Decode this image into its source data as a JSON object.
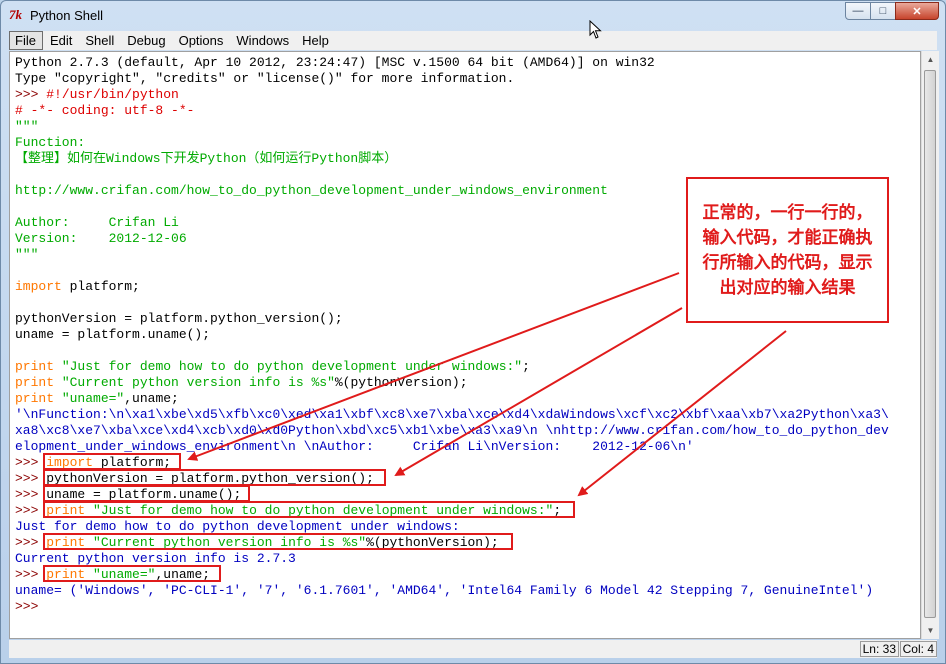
{
  "window": {
    "icon_text": "7k",
    "title": "Python Shell",
    "controls": {
      "minimize": "—",
      "maximize": "□",
      "close": "✕"
    }
  },
  "menu": [
    "File",
    "Edit",
    "Shell",
    "Debug",
    "Options",
    "Windows",
    "Help"
  ],
  "shell_lines": [
    [
      {
        "c": "out",
        "t": "Python 2.7.3 (default, Apr 10 2012, 23:24:47) [MSC v.1500 64 bit (AMD64)] on win32"
      }
    ],
    [
      {
        "c": "out",
        "t": "Type \"copyright\", \"credits\" or \"license()\" for more information."
      }
    ],
    [
      {
        "c": "prompt",
        "t": ">>> "
      },
      {
        "c": "comment",
        "t": "#!/usr/bin/python"
      }
    ],
    [
      {
        "c": "comment",
        "t": "# -*- coding: utf-8 -*-"
      }
    ],
    [
      {
        "c": "string",
        "t": "\"\"\""
      }
    ],
    [
      {
        "c": "string",
        "t": "Function:"
      }
    ],
    [
      {
        "c": "string",
        "t": "【整理】如何在Windows下开发Python（如何运行Python脚本）"
      }
    ],
    [
      {
        "c": "string",
        "t": ""
      }
    ],
    [
      {
        "c": "string",
        "t": "http://www.crifan.com/how_to_do_python_development_under_windows_environment"
      }
    ],
    [
      {
        "c": "string",
        "t": ""
      }
    ],
    [
      {
        "c": "string",
        "t": "Author:     Crifan Li"
      }
    ],
    [
      {
        "c": "string",
        "t": "Version:    2012-12-06"
      }
    ],
    [
      {
        "c": "string",
        "t": "\"\"\""
      }
    ],
    [
      {
        "c": "code",
        "t": ""
      }
    ],
    [
      {
        "c": "kw",
        "t": "import"
      },
      {
        "c": "code",
        "t": " platform;"
      }
    ],
    [
      {
        "c": "code",
        "t": ""
      }
    ],
    [
      {
        "c": "code",
        "t": "pythonVersion = platform.python_version();"
      }
    ],
    [
      {
        "c": "code",
        "t": "uname = platform.uname();"
      }
    ],
    [
      {
        "c": "code",
        "t": ""
      }
    ],
    [
      {
        "c": "kw",
        "t": "print"
      },
      {
        "c": "code",
        "t": " "
      },
      {
        "c": "string",
        "t": "\"Just for demo how to do python development under windows:\""
      },
      {
        "c": "code",
        "t": ";"
      }
    ],
    [
      {
        "c": "kw",
        "t": "print"
      },
      {
        "c": "code",
        "t": " "
      },
      {
        "c": "string",
        "t": "\"Current python version info is %s\""
      },
      {
        "c": "code",
        "t": "%(pythonVersion);"
      }
    ],
    [
      {
        "c": "kw",
        "t": "print"
      },
      {
        "c": "code",
        "t": " "
      },
      {
        "c": "string",
        "t": "\"uname=\""
      },
      {
        "c": "code",
        "t": ",uname;"
      }
    ],
    [
      {
        "c": "res",
        "t": "'\\nFunction:\\n\\xa1\\xbe\\xd5\\xfb\\xc0\\xed\\xa1\\xbf\\xc8\\xe7\\xba\\xce\\xd4\\xdaWindows\\xcf\\xc2\\xbf\\xaa\\xb7\\xa2Python\\xa3\\"
      }
    ],
    [
      {
        "c": "res",
        "t": "xa8\\xc8\\xe7\\xba\\xce\\xd4\\xcb\\xd0\\xd0Python\\xbd\\xc5\\xb1\\xbe\\xa3\\xa9\\n \\nhttp://www.crifan.com/how_to_do_python_dev"
      }
    ],
    [
      {
        "c": "res",
        "t": "elopment_under_windows_environment\\n \\nAuthor:     Crifan Li\\nVersion:    2012-12-06\\n'"
      }
    ],
    [
      {
        "c": "prompt",
        "t": ">>> "
      },
      {
        "c": "kw",
        "t": "import"
      },
      {
        "c": "code",
        "t": " platform;"
      }
    ],
    [
      {
        "c": "prompt",
        "t": ">>> "
      },
      {
        "c": "code",
        "t": "pythonVersion = platform.python_version();"
      }
    ],
    [
      {
        "c": "prompt",
        "t": ">>> "
      },
      {
        "c": "code",
        "t": "uname = platform.uname();"
      }
    ],
    [
      {
        "c": "prompt",
        "t": ">>> "
      },
      {
        "c": "kw",
        "t": "print"
      },
      {
        "c": "code",
        "t": " "
      },
      {
        "c": "string",
        "t": "\"Just for demo how to do python development under windows:\""
      },
      {
        "c": "code",
        "t": ";"
      }
    ],
    [
      {
        "c": "res",
        "t": "Just for demo how to do python development under windows:"
      }
    ],
    [
      {
        "c": "prompt",
        "t": ">>> "
      },
      {
        "c": "kw",
        "t": "print"
      },
      {
        "c": "code",
        "t": " "
      },
      {
        "c": "string",
        "t": "\"Current python version info is %s\""
      },
      {
        "c": "code",
        "t": "%(pythonVersion);"
      }
    ],
    [
      {
        "c": "res",
        "t": "Current python version info is 2.7.3"
      }
    ],
    [
      {
        "c": "prompt",
        "t": ">>> "
      },
      {
        "c": "kw",
        "t": "print"
      },
      {
        "c": "code",
        "t": " "
      },
      {
        "c": "string",
        "t": "\"uname=\""
      },
      {
        "c": "code",
        "t": ",uname;"
      }
    ],
    [
      {
        "c": "res",
        "t": "uname= ('Windows', 'PC-CLI-1', '7', '6.1.7601', 'AMD64', 'Intel64 Family 6 Model 42 Stepping 7, GenuineIntel')"
      }
    ],
    [
      {
        "c": "prompt",
        "t": ">>> "
      }
    ]
  ],
  "annotation": {
    "lines": [
      "正常的，一行一行的，",
      "输入代码，才能正确执",
      "行所输入的代码，显示",
      "出对应的输入结果"
    ]
  },
  "statusbar": {
    "line": "Ln: 33",
    "col": "Col: 4"
  },
  "colors": {
    "prompt": "#8b0000",
    "comment": "#dd0000",
    "string": "#00aa00",
    "keyword": "#ff7700",
    "output": "#0000c0",
    "annotation": "#e01b1b"
  }
}
